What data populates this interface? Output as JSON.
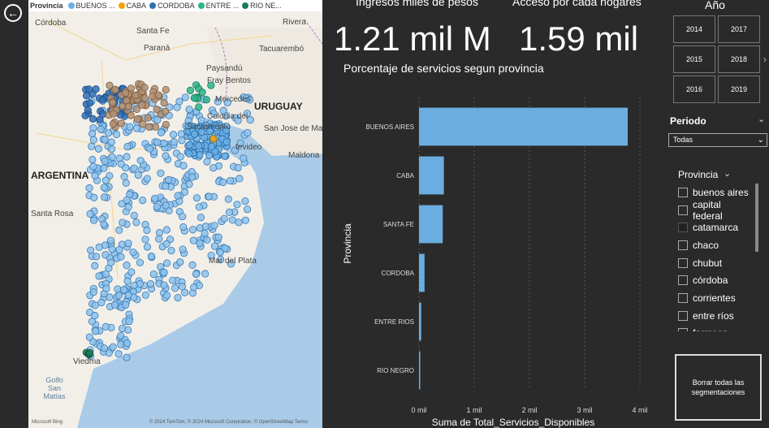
{
  "nav": {
    "back_icon": "arrow-left-circle-icon"
  },
  "map": {
    "legend": {
      "title": "Provincia",
      "items": [
        {
          "label": "BUENOS ...",
          "color": "#6ab0e6"
        },
        {
          "label": "CABA",
          "color": "#f0a30a"
        },
        {
          "label": "CORDOBA",
          "color": "#2f6fb5"
        },
        {
          "label": "ENTRE ...",
          "color": "#2bb589"
        },
        {
          "label": "RIO NE...",
          "color": "#1b7a5a"
        }
      ]
    },
    "labels": {
      "cordoba": "Córdoba",
      "santa_fe": "Santa Fe",
      "parana": "Paraná",
      "rivera": "Rivera",
      "tacuarembo": "Tacuarembó",
      "paysandu": "Paysandú",
      "fray_bentos": "Fray Bentos",
      "mercedes": "Mercedes",
      "colonia": "Colonia del",
      "sacramento": "Sacramento",
      "uruguay": "URUGUAY",
      "san_jose": "San Jose de May",
      "montevideo": "tevideo",
      "maldonado": "Maldona",
      "argentina": "ARGENTINA",
      "santa_rosa": "Santa Rosa",
      "mar_del_plata": "Mar del Plata",
      "viedma": "Viedma",
      "golfo": "Golfo San Matías"
    },
    "footer_left": "Microsoft Bing",
    "footer_right": "© 2024 TomTom, © 2024 Microsoft Corporation, © OpenStreetMap  Terms"
  },
  "kpis": [
    {
      "label": "Ingresos miles de pesos",
      "value": "1.21 mil M"
    },
    {
      "label": "Acceso por cada hogares",
      "value": "1.59 mil"
    }
  ],
  "chart_data": {
    "type": "bar",
    "orientation": "horizontal",
    "title": "Porcentaje de servicios segun provincia",
    "xlabel": "Suma de Total_Servicios_Disponibles",
    "ylabel": "Provincia",
    "categories": [
      "BUENOS AIRES",
      "CABA",
      "SANTA FE",
      "CORDOBA",
      "ENTRE RIOS",
      "RIO NEGRO"
    ],
    "values": [
      3780,
      450,
      430,
      100,
      40,
      10
    ],
    "xlim": [
      0,
      4000
    ],
    "xticks": [
      0,
      1000,
      2000,
      3000,
      4000
    ],
    "xtick_labels": [
      "0 mil",
      "1 mil",
      "2 mil",
      "3 mil",
      "4 mil"
    ],
    "bar_color": "#6aaee0",
    "grid": true
  },
  "year_slicer": {
    "title": "Año",
    "years": [
      "2014",
      "2017",
      "2015",
      "2018",
      "2016",
      "2019"
    ],
    "next_icon": "chevron-right-icon"
  },
  "periodo": {
    "title": "Periodo",
    "selected": "Todas"
  },
  "provincia_slicer": {
    "title": "Provincia",
    "items": [
      {
        "label": "buenos aires",
        "checked": false
      },
      {
        "label": "capital federal",
        "checked": false
      },
      {
        "label": "catamarca",
        "checked": true
      },
      {
        "label": "chaco",
        "checked": false
      },
      {
        "label": "chubut",
        "checked": false
      },
      {
        "label": "córdoba",
        "checked": false
      },
      {
        "label": "corrientes",
        "checked": false
      },
      {
        "label": "entre ríos",
        "checked": false
      },
      {
        "label": "formosa",
        "checked": false
      }
    ]
  },
  "clear_button": {
    "label": "Borrar todas las segmentaciones"
  }
}
